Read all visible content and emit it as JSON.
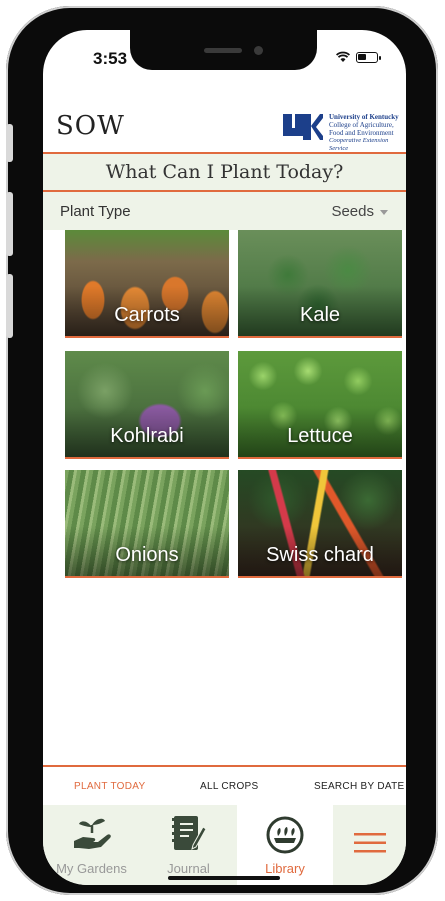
{
  "status_bar": {
    "time": "3:53"
  },
  "header": {
    "app_name": "SOW",
    "org": {
      "line1": "University of Kentucky",
      "line2": "College of Agriculture,",
      "line3": "Food and Environment",
      "line4": "Cooperative Extension Service"
    }
  },
  "page_title": "What Can I Plant Today?",
  "filter": {
    "label": "Plant Type",
    "value": "Seeds"
  },
  "plants": [
    {
      "name": "Carrots"
    },
    {
      "name": "Kale"
    },
    {
      "name": "Kohlrabi"
    },
    {
      "name": "Lettuce"
    },
    {
      "name": "Onions"
    },
    {
      "name": "Swiss chard"
    }
  ],
  "subtabs": [
    {
      "label": "PLANT TODAY",
      "active": true
    },
    {
      "label": "ALL CROPS",
      "active": false
    },
    {
      "label": "SEARCH BY DATE",
      "active": false
    }
  ],
  "tabbar": [
    {
      "label": "My Gardens",
      "icon": "hand-plant-icon"
    },
    {
      "label": "Journal",
      "icon": "journal-icon"
    },
    {
      "label": "Library",
      "icon": "library-icon",
      "active": true
    },
    {
      "label": "",
      "icon": "menu-icon"
    }
  ],
  "colors": {
    "accent": "#e06a3e",
    "bar_bg": "#eef3e8",
    "uk_blue": "#1c3f8a"
  }
}
